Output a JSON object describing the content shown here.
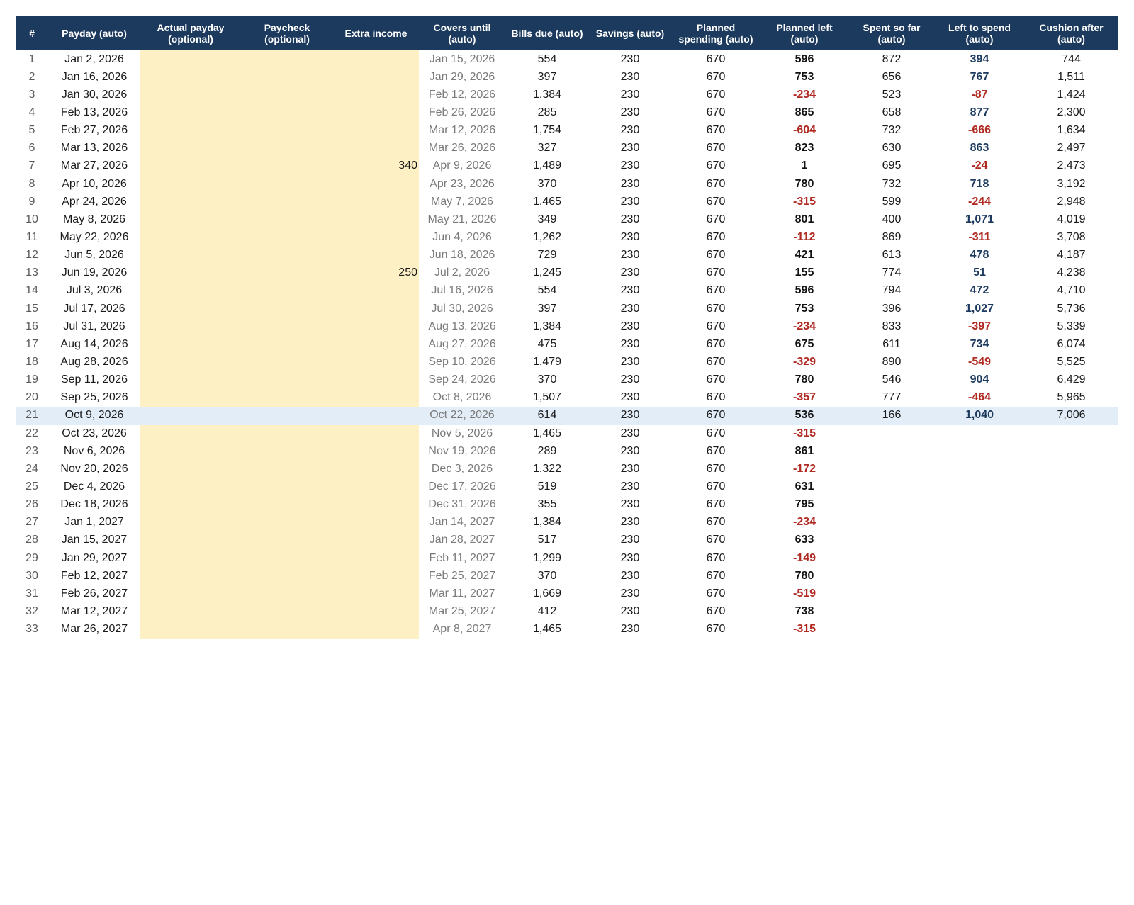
{
  "columns": [
    "#",
    "Payday (auto)",
    "Actual payday\n(optional)",
    "Paycheck\n(optional)",
    "Extra income",
    "Covers until\n(auto)",
    "Bills due (auto)",
    "Savings (auto)",
    "Planned\nspending (auto)",
    "Planned left\n(auto)",
    "Spent so far\n(auto)",
    "Left to spend\n(auto)",
    "Cushion after\n(auto)"
  ],
  "current_row": "21",
  "colors": {
    "header_bg": "#1c3a5e",
    "input_bg": "#fdf0c5",
    "current_row_bg": "#e3edf8",
    "negative": "#b02a22",
    "positive_accent": "#1c3a5e"
  },
  "rows": [
    {
      "n": "1",
      "payday": "Jan 2, 2026",
      "actual": "",
      "paycheck": "",
      "extra": "",
      "covers": "Jan 15, 2026",
      "bills": "554",
      "savings": "230",
      "planned": "670",
      "left": "596",
      "spent": "872",
      "left_to_spend": "394",
      "cushion": "744"
    },
    {
      "n": "2",
      "payday": "Jan 16, 2026",
      "actual": "",
      "paycheck": "",
      "extra": "",
      "covers": "Jan 29, 2026",
      "bills": "397",
      "savings": "230",
      "planned": "670",
      "left": "753",
      "spent": "656",
      "left_to_spend": "767",
      "cushion": "1,511"
    },
    {
      "n": "3",
      "payday": "Jan 30, 2026",
      "actual": "",
      "paycheck": "",
      "extra": "",
      "covers": "Feb 12, 2026",
      "bills": "1,384",
      "savings": "230",
      "planned": "670",
      "left": "-234",
      "spent": "523",
      "left_to_spend": "-87",
      "cushion": "1,424"
    },
    {
      "n": "4",
      "payday": "Feb 13, 2026",
      "actual": "",
      "paycheck": "",
      "extra": "",
      "covers": "Feb 26, 2026",
      "bills": "285",
      "savings": "230",
      "planned": "670",
      "left": "865",
      "spent": "658",
      "left_to_spend": "877",
      "cushion": "2,300"
    },
    {
      "n": "5",
      "payday": "Feb 27, 2026",
      "actual": "",
      "paycheck": "",
      "extra": "",
      "covers": "Mar 12, 2026",
      "bills": "1,754",
      "savings": "230",
      "planned": "670",
      "left": "-604",
      "spent": "732",
      "left_to_spend": "-666",
      "cushion": "1,634"
    },
    {
      "n": "6",
      "payday": "Mar 13, 2026",
      "actual": "",
      "paycheck": "",
      "extra": "",
      "covers": "Mar 26, 2026",
      "bills": "327",
      "savings": "230",
      "planned": "670",
      "left": "823",
      "spent": "630",
      "left_to_spend": "863",
      "cushion": "2,497"
    },
    {
      "n": "7",
      "payday": "Mar 27, 2026",
      "actual": "",
      "paycheck": "",
      "extra": "340",
      "covers": "Apr 9, 2026",
      "bills": "1,489",
      "savings": "230",
      "planned": "670",
      "left": "1",
      "spent": "695",
      "left_to_spend": "-24",
      "cushion": "2,473"
    },
    {
      "n": "8",
      "payday": "Apr 10, 2026",
      "actual": "",
      "paycheck": "",
      "extra": "",
      "covers": "Apr 23, 2026",
      "bills": "370",
      "savings": "230",
      "planned": "670",
      "left": "780",
      "spent": "732",
      "left_to_spend": "718",
      "cushion": "3,192"
    },
    {
      "n": "9",
      "payday": "Apr 24, 2026",
      "actual": "",
      "paycheck": "",
      "extra": "",
      "covers": "May 7, 2026",
      "bills": "1,465",
      "savings": "230",
      "planned": "670",
      "left": "-315",
      "spent": "599",
      "left_to_spend": "-244",
      "cushion": "2,948"
    },
    {
      "n": "10",
      "payday": "May 8, 2026",
      "actual": "",
      "paycheck": "",
      "extra": "",
      "covers": "May 21, 2026",
      "bills": "349",
      "savings": "230",
      "planned": "670",
      "left": "801",
      "spent": "400",
      "left_to_spend": "1,071",
      "cushion": "4,019"
    },
    {
      "n": "11",
      "payday": "May 22, 2026",
      "actual": "",
      "paycheck": "",
      "extra": "",
      "covers": "Jun 4, 2026",
      "bills": "1,262",
      "savings": "230",
      "planned": "670",
      "left": "-112",
      "spent": "869",
      "left_to_spend": "-311",
      "cushion": "3,708"
    },
    {
      "n": "12",
      "payday": "Jun 5, 2026",
      "actual": "",
      "paycheck": "",
      "extra": "",
      "covers": "Jun 18, 2026",
      "bills": "729",
      "savings": "230",
      "planned": "670",
      "left": "421",
      "spent": "613",
      "left_to_spend": "478",
      "cushion": "4,187"
    },
    {
      "n": "13",
      "payday": "Jun 19, 2026",
      "actual": "",
      "paycheck": "",
      "extra": "250",
      "covers": "Jul 2, 2026",
      "bills": "1,245",
      "savings": "230",
      "planned": "670",
      "left": "155",
      "spent": "774",
      "left_to_spend": "51",
      "cushion": "4,238"
    },
    {
      "n": "14",
      "payday": "Jul 3, 2026",
      "actual": "",
      "paycheck": "",
      "extra": "",
      "covers": "Jul 16, 2026",
      "bills": "554",
      "savings": "230",
      "planned": "670",
      "left": "596",
      "spent": "794",
      "left_to_spend": "472",
      "cushion": "4,710"
    },
    {
      "n": "15",
      "payday": "Jul 17, 2026",
      "actual": "",
      "paycheck": "",
      "extra": "",
      "covers": "Jul 30, 2026",
      "bills": "397",
      "savings": "230",
      "planned": "670",
      "left": "753",
      "spent": "396",
      "left_to_spend": "1,027",
      "cushion": "5,736"
    },
    {
      "n": "16",
      "payday": "Jul 31, 2026",
      "actual": "",
      "paycheck": "",
      "extra": "",
      "covers": "Aug 13, 2026",
      "bills": "1,384",
      "savings": "230",
      "planned": "670",
      "left": "-234",
      "spent": "833",
      "left_to_spend": "-397",
      "cushion": "5,339"
    },
    {
      "n": "17",
      "payday": "Aug 14, 2026",
      "actual": "",
      "paycheck": "",
      "extra": "",
      "covers": "Aug 27, 2026",
      "bills": "475",
      "savings": "230",
      "planned": "670",
      "left": "675",
      "spent": "611",
      "left_to_spend": "734",
      "cushion": "6,074"
    },
    {
      "n": "18",
      "payday": "Aug 28, 2026",
      "actual": "",
      "paycheck": "",
      "extra": "",
      "covers": "Sep 10, 2026",
      "bills": "1,479",
      "savings": "230",
      "planned": "670",
      "left": "-329",
      "spent": "890",
      "left_to_spend": "-549",
      "cushion": "5,525"
    },
    {
      "n": "19",
      "payday": "Sep 11, 2026",
      "actual": "",
      "paycheck": "",
      "extra": "",
      "covers": "Sep 24, 2026",
      "bills": "370",
      "savings": "230",
      "planned": "670",
      "left": "780",
      "spent": "546",
      "left_to_spend": "904",
      "cushion": "6,429"
    },
    {
      "n": "20",
      "payday": "Sep 25, 2026",
      "actual": "",
      "paycheck": "",
      "extra": "",
      "covers": "Oct 8, 2026",
      "bills": "1,507",
      "savings": "230",
      "planned": "670",
      "left": "-357",
      "spent": "777",
      "left_to_spend": "-464",
      "cushion": "5,965"
    },
    {
      "n": "21",
      "payday": "Oct 9, 2026",
      "actual": "",
      "paycheck": "",
      "extra": "",
      "covers": "Oct 22, 2026",
      "bills": "614",
      "savings": "230",
      "planned": "670",
      "left": "536",
      "spent": "166",
      "left_to_spend": "1,040",
      "cushion": "7,006"
    },
    {
      "n": "22",
      "payday": "Oct 23, 2026",
      "actual": "",
      "paycheck": "",
      "extra": "",
      "covers": "Nov 5, 2026",
      "bills": "1,465",
      "savings": "230",
      "planned": "670",
      "left": "-315",
      "spent": "",
      "left_to_spend": "",
      "cushion": ""
    },
    {
      "n": "23",
      "payday": "Nov 6, 2026",
      "actual": "",
      "paycheck": "",
      "extra": "",
      "covers": "Nov 19, 2026",
      "bills": "289",
      "savings": "230",
      "planned": "670",
      "left": "861",
      "spent": "",
      "left_to_spend": "",
      "cushion": ""
    },
    {
      "n": "24",
      "payday": "Nov 20, 2026",
      "actual": "",
      "paycheck": "",
      "extra": "",
      "covers": "Dec 3, 2026",
      "bills": "1,322",
      "savings": "230",
      "planned": "670",
      "left": "-172",
      "spent": "",
      "left_to_spend": "",
      "cushion": ""
    },
    {
      "n": "25",
      "payday": "Dec 4, 2026",
      "actual": "",
      "paycheck": "",
      "extra": "",
      "covers": "Dec 17, 2026",
      "bills": "519",
      "savings": "230",
      "planned": "670",
      "left": "631",
      "spent": "",
      "left_to_spend": "",
      "cushion": ""
    },
    {
      "n": "26",
      "payday": "Dec 18, 2026",
      "actual": "",
      "paycheck": "",
      "extra": "",
      "covers": "Dec 31, 2026",
      "bills": "355",
      "savings": "230",
      "planned": "670",
      "left": "795",
      "spent": "",
      "left_to_spend": "",
      "cushion": ""
    },
    {
      "n": "27",
      "payday": "Jan 1, 2027",
      "actual": "",
      "paycheck": "",
      "extra": "",
      "covers": "Jan 14, 2027",
      "bills": "1,384",
      "savings": "230",
      "planned": "670",
      "left": "-234",
      "spent": "",
      "left_to_spend": "",
      "cushion": ""
    },
    {
      "n": "28",
      "payday": "Jan 15, 2027",
      "actual": "",
      "paycheck": "",
      "extra": "",
      "covers": "Jan 28, 2027",
      "bills": "517",
      "savings": "230",
      "planned": "670",
      "left": "633",
      "spent": "",
      "left_to_spend": "",
      "cushion": ""
    },
    {
      "n": "29",
      "payday": "Jan 29, 2027",
      "actual": "",
      "paycheck": "",
      "extra": "",
      "covers": "Feb 11, 2027",
      "bills": "1,299",
      "savings": "230",
      "planned": "670",
      "left": "-149",
      "spent": "",
      "left_to_spend": "",
      "cushion": ""
    },
    {
      "n": "30",
      "payday": "Feb 12, 2027",
      "actual": "",
      "paycheck": "",
      "extra": "",
      "covers": "Feb 25, 2027",
      "bills": "370",
      "savings": "230",
      "planned": "670",
      "left": "780",
      "spent": "",
      "left_to_spend": "",
      "cushion": ""
    },
    {
      "n": "31",
      "payday": "Feb 26, 2027",
      "actual": "",
      "paycheck": "",
      "extra": "",
      "covers": "Mar 11, 2027",
      "bills": "1,669",
      "savings": "230",
      "planned": "670",
      "left": "-519",
      "spent": "",
      "left_to_spend": "",
      "cushion": ""
    },
    {
      "n": "32",
      "payday": "Mar 12, 2027",
      "actual": "",
      "paycheck": "",
      "extra": "",
      "covers": "Mar 25, 2027",
      "bills": "412",
      "savings": "230",
      "planned": "670",
      "left": "738",
      "spent": "",
      "left_to_spend": "",
      "cushion": ""
    },
    {
      "n": "33",
      "payday": "Mar 26, 2027",
      "actual": "",
      "paycheck": "",
      "extra": "",
      "covers": "Apr 8, 2027",
      "bills": "1,465",
      "savings": "230",
      "planned": "670",
      "left": "-315",
      "spent": "",
      "left_to_spend": "",
      "cushion": ""
    }
  ]
}
